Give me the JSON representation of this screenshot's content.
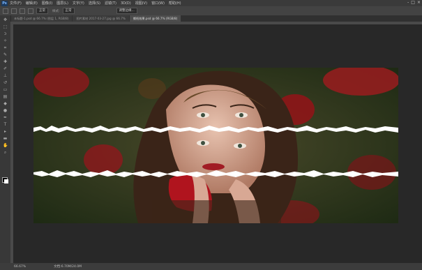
{
  "app": {
    "logo": "Ps"
  },
  "menu": [
    "文件(F)",
    "编辑(E)",
    "图像(I)",
    "图层(L)",
    "文字(Y)",
    "选择(S)",
    "滤镜(T)",
    "3D(D)",
    "视图(V)",
    "窗口(W)",
    "帮助(H)"
  ],
  "window_controls": [
    "-",
    "□",
    "×"
  ],
  "options": {
    "mode_value": "正常",
    "style_label": "样式:",
    "style_value": "正常",
    "refine_label": "调整边缘..."
  },
  "tabs": [
    {
      "label": "未标题-1.psd @ 66.7% (图层 1, RGB/8)"
    },
    {
      "label": "图片素材 2017-03-27.jpg @ 66.7%"
    },
    {
      "label": "撕纸效果.psd @ 66.7% (RGB/8)"
    }
  ],
  "status": {
    "zoom": "66.67%",
    "doc": "文档:6.70M/24.0M"
  }
}
